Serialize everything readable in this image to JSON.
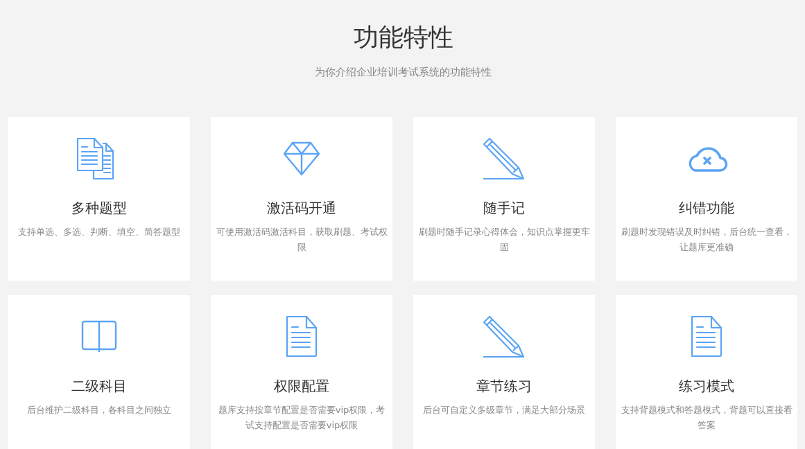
{
  "header": {
    "title": "功能特性",
    "subtitle": "为你介绍企业培训考试系统的功能特性"
  },
  "features": [
    {
      "kind": "documents",
      "title": "多种题型",
      "description": "支持单选、多选、判断、填空、简答题型"
    },
    {
      "kind": "diamond",
      "title": "激活码开通",
      "description": "可使用激活码激活科目，获取刷题、考试权限"
    },
    {
      "kind": "pencil",
      "title": "随手记",
      "description": "刷题时随手记录心得体会，知识点掌握更牢固"
    },
    {
      "kind": "cloud-x",
      "title": "纠错功能",
      "description": "刷题时发现错误及时纠错，后台统一查看，让题库更准确"
    },
    {
      "kind": "book",
      "title": "二级科目",
      "description": "后台维护二级科目，各科目之间独立"
    },
    {
      "kind": "document",
      "title": "权限配置",
      "description": "题库支持按章节配置是否需要vip权限，考试支持配置是否需要vip权限"
    },
    {
      "kind": "pencil",
      "title": "章节练习",
      "description": "后台可自定义多级章节，满足大部分场景"
    },
    {
      "kind": "document",
      "title": "练习模式",
      "description": "支持背题模式和答题模式，背题可以直接看答案"
    }
  ]
}
